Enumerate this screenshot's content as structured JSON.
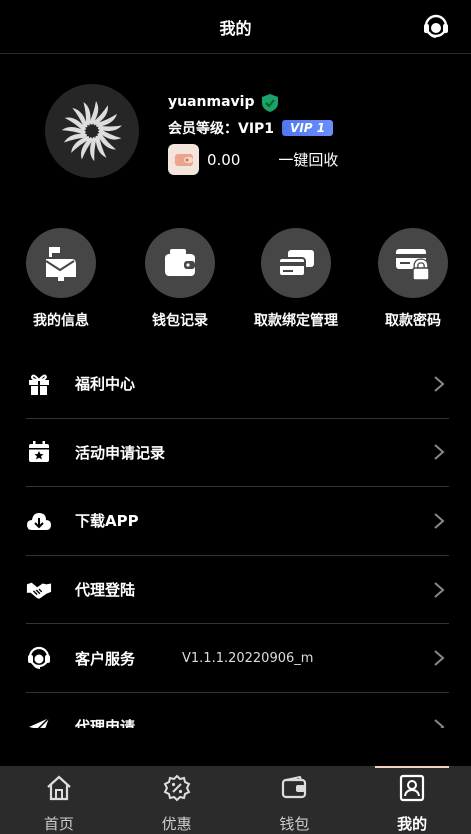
{
  "header": {
    "title": "我的",
    "cs_icon": "headset-icon"
  },
  "profile": {
    "username": "yuanmavip",
    "level_label": "会员等级：VIP1",
    "vip_badge": "VIP 1",
    "balance": "0.00",
    "recycle_label": "一键回收",
    "colors": {
      "vip": "#4e78f0",
      "shield": "#1aa26a"
    }
  },
  "shortcuts": [
    {
      "label": "我的信息",
      "icon": "mailbox-icon"
    },
    {
      "label": "钱包记录",
      "icon": "wallet-icon"
    },
    {
      "label": "取款绑定管理",
      "icon": "cards-icon"
    },
    {
      "label": "取款密码",
      "icon": "card-lock-icon"
    }
  ],
  "menu": [
    {
      "label": "福利中心",
      "icon": "gift-icon"
    },
    {
      "label": "活动申请记录",
      "icon": "calendar-star-icon"
    },
    {
      "label": "下载APP",
      "icon": "cloud-download-icon"
    },
    {
      "label": "代理登陆",
      "icon": "handshake-icon"
    },
    {
      "label": "客户服务",
      "icon": "headset-icon",
      "version": "V1.1.1.20220906_m"
    },
    {
      "label": "代理申请",
      "icon": "paper-plane-icon"
    }
  ],
  "tabbar": [
    {
      "label": "首页",
      "icon": "home-icon"
    },
    {
      "label": "优惠",
      "icon": "discount-icon"
    },
    {
      "label": "钱包",
      "icon": "wallet-icon"
    },
    {
      "label": "我的",
      "icon": "user-icon",
      "active": true
    }
  ]
}
